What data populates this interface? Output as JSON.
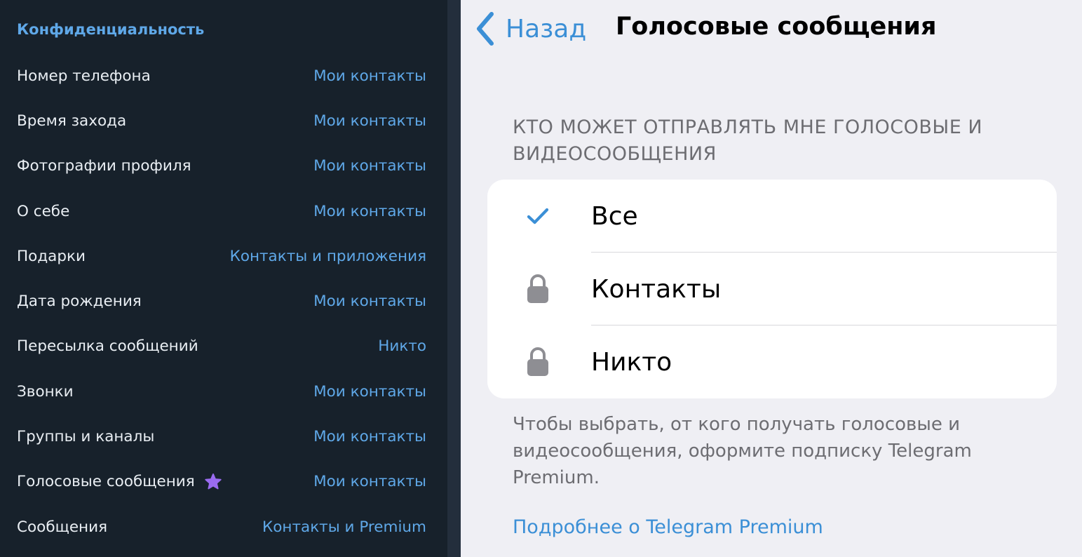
{
  "privacy_panel": {
    "header": "Конфиденциальность",
    "rows": [
      {
        "label": "Номер телефона",
        "value": "Мои контакты"
      },
      {
        "label": "Время захода",
        "value": "Мои контакты"
      },
      {
        "label": "Фотографии профиля",
        "value": "Мои контакты"
      },
      {
        "label": "О себе",
        "value": "Мои контакты"
      },
      {
        "label": "Подарки",
        "value": "Контакты и приложения"
      },
      {
        "label": "Дата рождения",
        "value": "Мои контакты"
      },
      {
        "label": "Пересылка сообщений",
        "value": "Никто"
      },
      {
        "label": "Звонки",
        "value": "Мои контакты"
      },
      {
        "label": "Группы и каналы",
        "value": "Мои контакты"
      },
      {
        "label": "Голосовые сообщения",
        "value": "Мои контакты",
        "premium_icon": "star-icon"
      },
      {
        "label": "Сообщения",
        "value": "Контакты и Premium"
      }
    ]
  },
  "voice_messages_screen": {
    "back_label": "Назад",
    "title": "Голосовые сообщения",
    "section_header": "КТО МОЖЕТ ОТПРАВЛЯТЬ МНЕ ГОЛОСОВЫЕ И ВИДЕОСООБЩЕНИЯ",
    "options": [
      {
        "label": "Все",
        "icon": "checkmark-icon",
        "selected": true
      },
      {
        "label": "Контакты",
        "icon": "lock-icon",
        "selected": false
      },
      {
        "label": "Никто",
        "icon": "lock-icon",
        "selected": false
      }
    ],
    "footer_text": "Чтобы выбрать, от кого получать голосовые и видеосообщения, оформите подписку Telegram Premium.",
    "footer_link": "Подробнее о Telegram Premium"
  },
  "colors": {
    "dark_bg": "#17212b",
    "accent_blue_dark": "#5fa8e8",
    "accent_blue_light": "#3b8fd6",
    "premium_star": "#9a6bf0",
    "check": "#3b8fd6",
    "lock": "#8e8e93"
  }
}
